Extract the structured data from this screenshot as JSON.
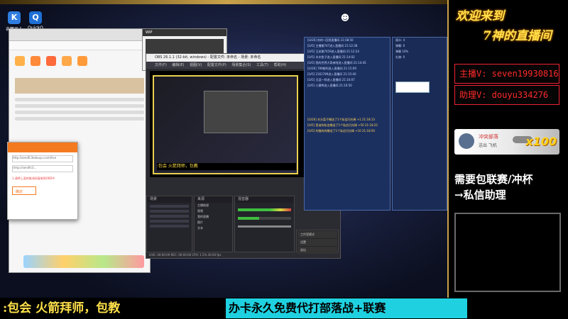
{
  "desktop": {
    "icons": [
      {
        "label": "亲畅画人",
        "glyph": "K",
        "icon": "kugou-icon"
      },
      {
        "label": "QuickQ",
        "glyph": "Q",
        "icon": "quickq-icon"
      }
    ]
  },
  "smallwin": {
    "title": "WIP"
  },
  "obs": {
    "title": "OBS 26.1.1 (32-bit, windows) - 配置文件: 未命名 - 场景: 未命名",
    "menu": "文件(F) 编辑(E) 视图(V) 配置文件(P) 场景集合(S) 工具(T) 帮助(H)",
    "scenes_header": "场景",
    "sources_header": "来源",
    "mixer_header": "混音器",
    "sources": [
      "主播助理",
      "视频",
      "我的直播",
      "图片",
      "文本"
    ],
    "controls": [
      "工作室模式",
      "设置",
      "退出"
    ],
    "status": "LIVE: 00:00:00  REC: 00:00:00  CPU: 1.5%  30.00 fps"
  },
  "browser": {
    "dialog": {
      "fields": [
        "http://sendfc3edouyu.com/live",
        "rtmp://sendfc3..."
      ],
      "link_label": "复制",
      "note": "1.请将上面的推流码复制到OBS中",
      "ok_label": "确定"
    }
  },
  "chat": {
    "lines": [
      "[LV26] 你的~回到直播间 21:08:50",
      "[LV5] 主播猪747进入直播间 21:12:38",
      "[LV5] 玉米猪7459进入直播间 21:12:24",
      "[LV5] 木木鱼子进入直播间 21:14:02",
      "[LV5] 我的世界大哥来啦进入直播间 21:14:45",
      "[LV26] 789都叫进入直播间 21:15:09",
      "[LV5] 2161789进入直播间 21:15:40",
      "[LV5] 天涯一样进入直播间 21:16:07",
      "[LV5] 小黄鸭进入直播间 21:16:50",
      "[LV26] 木头菜子赠送了1个私信闪光棒 +1 21:18:13",
      "[LV5] 是谁的私信赠送了1个私信闪光棒 +50 21:18:22",
      "[LV5] 的猫的的赠送了1个私信闪光棒 +10 21:18:50"
    ],
    "stats": [
      "观众: 4",
      "弹幕: 0",
      "弹幕 10%",
      "礼物: 0"
    ]
  },
  "overlay": {
    "welcome_line1": "欢迎来到",
    "welcome_line2": "7神的直播间",
    "host": "主播V: seven19930816",
    "assistant": "助理V: douyu334276",
    "gift_title": "冲突部落",
    "gift_sub": "送出 飞机",
    "gift_count": "x100",
    "promo_line1": "需要包联赛/冲杯",
    "promo_line2": "→私信助理"
  },
  "ticker": {
    "left": ":包会   火箭拜师，包教",
    "box": "办卡永久免费代打部落战+联赛"
  },
  "colors": {
    "accent_yellow": "#ffe04a",
    "ticker_cyan": "#1fd1e0",
    "contact_red": "#ff2a2a"
  }
}
